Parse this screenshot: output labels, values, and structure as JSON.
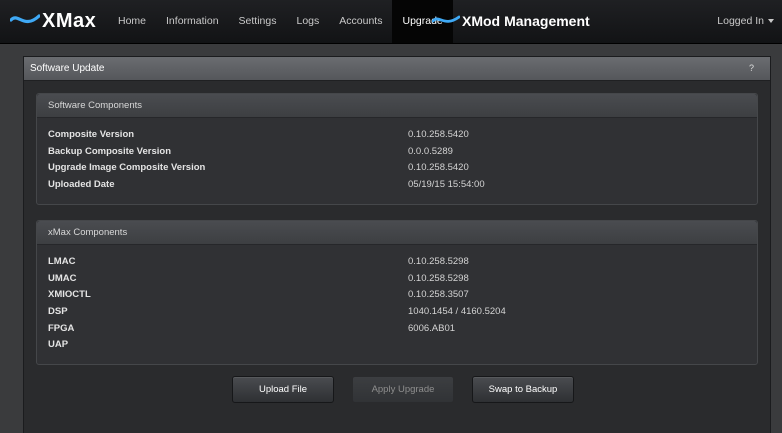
{
  "brand": {
    "name": "XMax"
  },
  "nav": {
    "items": [
      {
        "label": "Home"
      },
      {
        "label": "Information"
      },
      {
        "label": "Settings"
      },
      {
        "label": "Logs"
      },
      {
        "label": "Accounts"
      },
      {
        "label": "Upgrade",
        "active": true
      }
    ],
    "mod_brand": "XMod",
    "mod_suffix": "Management",
    "user": "Logged In"
  },
  "panel": {
    "title": "Software Update",
    "help": "?"
  },
  "software": {
    "title": "Software Components",
    "rows": [
      {
        "label": "Composite Version",
        "value": "0.10.258.5420"
      },
      {
        "label": "Backup Composite Version",
        "value": "0.0.0.5289"
      },
      {
        "label": "Upgrade Image Composite Version",
        "value": "0.10.258.5420"
      },
      {
        "label": "Uploaded Date",
        "value": "05/19/15 15:54:00"
      }
    ]
  },
  "xmax": {
    "title": "xMax Components",
    "rows": [
      {
        "label": "LMAC",
        "value": "0.10.258.5298"
      },
      {
        "label": "UMAC",
        "value": "0.10.258.5298"
      },
      {
        "label": "XMIOCTL",
        "value": "0.10.258.3507"
      },
      {
        "label": "DSP",
        "value": "1040.1454 / 4160.5204"
      },
      {
        "label": "FPGA",
        "value": "6006.AB01"
      },
      {
        "label": "UAP",
        "value": ""
      }
    ]
  },
  "buttons": {
    "upload": "Upload File",
    "apply": "Apply Upgrade",
    "swap": "Swap to Backup"
  },
  "colors": {
    "accent": "#3fa9f5",
    "nav_bg": "#17181a",
    "panel_head": "#5f6165"
  }
}
